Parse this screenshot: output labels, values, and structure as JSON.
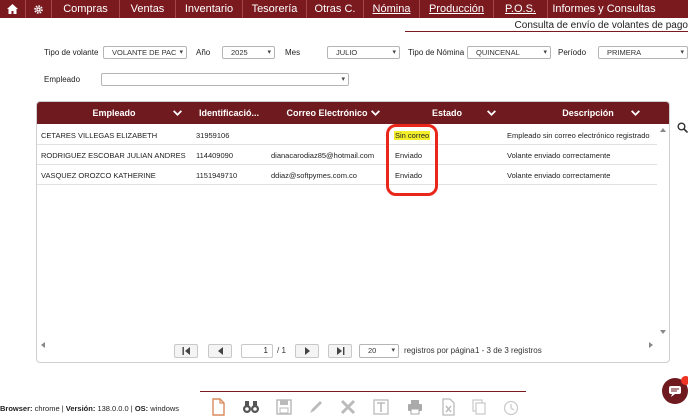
{
  "nav": {
    "items": [
      "Compras",
      "Ventas",
      "Inventario",
      "Tesorería",
      "Otras C.",
      "Nómina",
      "Producción",
      "P.O.S.",
      "Informes y Consultas"
    ]
  },
  "breadcrumb": "Consulta de envío de volantes de pago",
  "filters": {
    "tipo_volante_label": "Tipo de volante",
    "tipo_volante_value": "VOLANTE DE PAC",
    "anio_label": "Año",
    "anio_value": "2025",
    "mes_label": "Mes",
    "mes_value": "JULIO",
    "tipo_nomina_label": "Tipo de Nómina",
    "tipo_nomina_value": "QUINCENAL",
    "periodo_label": "Período",
    "periodo_value": "PRIMERA",
    "empleado_label": "Empleado",
    "empleado_value": ""
  },
  "grid": {
    "columns": [
      "Empleado",
      "Identificació...",
      "Correo Electrónico",
      "Estado",
      "Descripción"
    ],
    "rows": [
      {
        "empleado": "CETARES VILLEGAS ELIZABETH",
        "id": "31959106",
        "correo": "",
        "estado": "Sin correo",
        "descripcion": "Empleado sin correo electrónico registrado"
      },
      {
        "empleado": "RODRIGUEZ ESCOBAR JULIAN ANDRES",
        "id": "114409090",
        "correo": "dianacarodiaz85@hotmail.com",
        "estado": "Enviado",
        "descripcion": "Volante enviado correctamente"
      },
      {
        "empleado": "VASQUEZ OROZCO KATHERINE",
        "id": "1151949710",
        "correo": "ddiaz@softpymes.com.co",
        "estado": "Enviado",
        "descripcion": "Volante enviado correctamente"
      }
    ]
  },
  "pager": {
    "page": "1",
    "total_pages": "/ 1",
    "per_page": "20",
    "per_page_label": "registros por página",
    "range": "1 - 3 de 3 registros"
  },
  "footer": {
    "browser_label": "Browser:",
    "browser_value": "chrome",
    "version_label": "Versión:",
    "version_value": "138.0.0.0",
    "os_label": "OS:",
    "os_value": "windows"
  },
  "colors": {
    "brand": "#7a1a1f",
    "highlight": "#f3ef2a",
    "annotation": "#e8271a"
  }
}
